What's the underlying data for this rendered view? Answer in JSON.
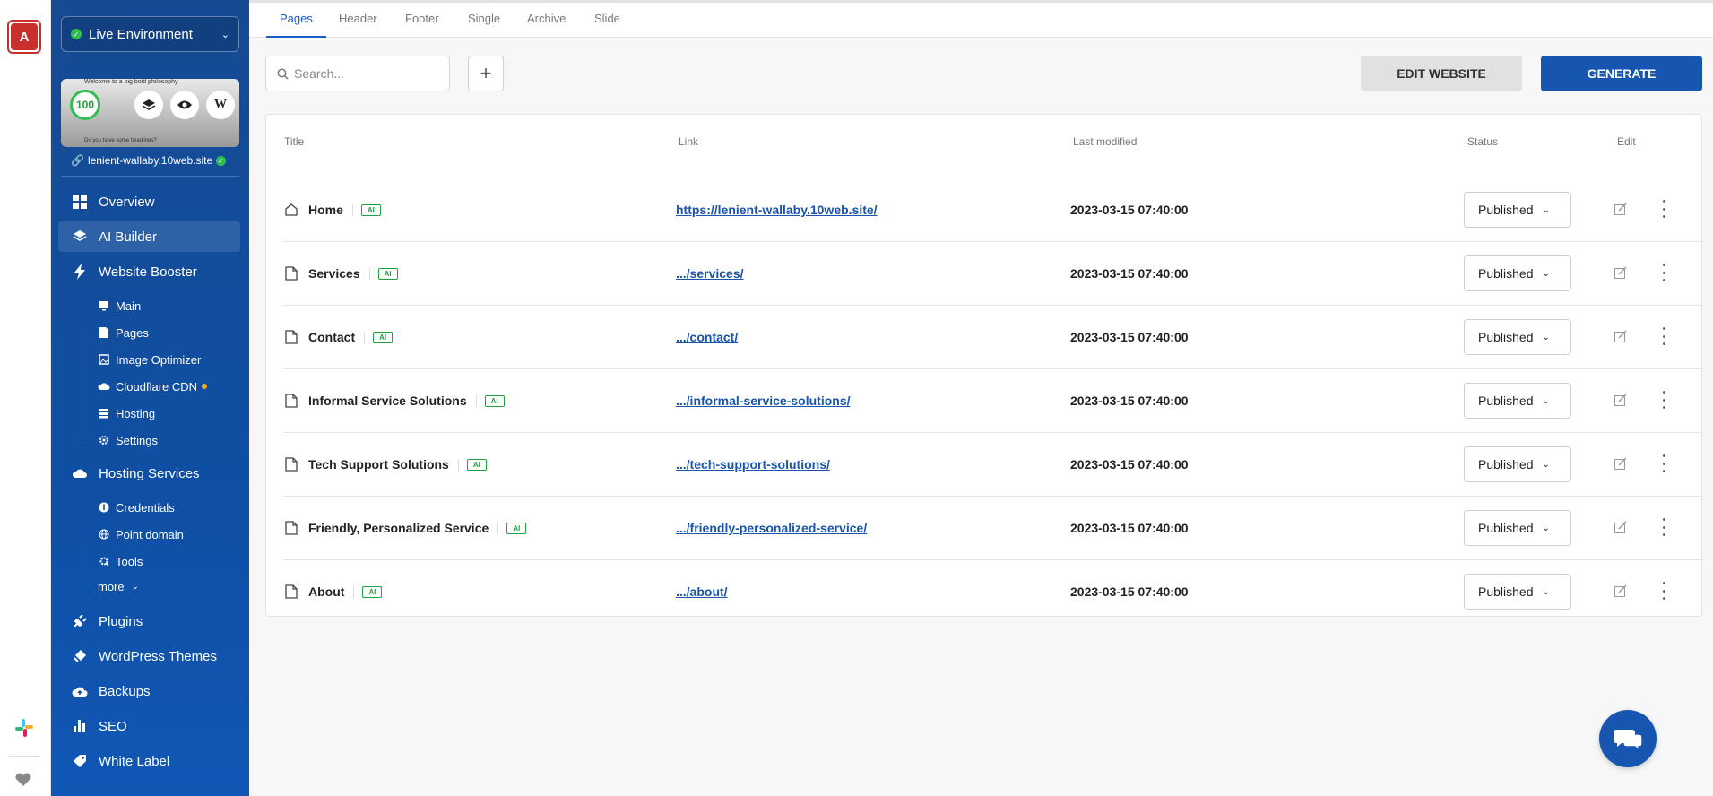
{
  "rail": {
    "avatar_letter": "A"
  },
  "sidebar": {
    "environment": "Live Environment",
    "preview": {
      "score": "100",
      "header_text": "Welcome to a big bold philosophy",
      "footer_text": "Do you have some headlines?"
    },
    "site_domain": "lenient-wallaby.10web.site",
    "nav": {
      "overview": "Overview",
      "ai_builder": "AI Builder",
      "website_booster": "Website Booster",
      "booster_sub": [
        "Main",
        "Pages",
        "Image Optimizer",
        "Cloudflare CDN",
        "Hosting",
        "Settings"
      ],
      "hosting_services": "Hosting Services",
      "hosting_sub": [
        "Credentials",
        "Point domain",
        "Tools"
      ],
      "more": "more",
      "plugins": "Plugins",
      "wordpress_themes": "WordPress Themes",
      "backups": "Backups",
      "seo": "SEO",
      "white_label": "White Label"
    }
  },
  "tabs": [
    "Pages",
    "Header",
    "Footer",
    "Single",
    "Archive",
    "Slide"
  ],
  "toolbar": {
    "search_placeholder": "Search...",
    "edit_website": "EDIT WEBSITE",
    "generate": "GENERATE"
  },
  "table": {
    "headers": {
      "title": "Title",
      "link": "Link",
      "modified": "Last modified",
      "status": "Status",
      "edit": "Edit"
    },
    "ai_label": "AI",
    "rows": [
      {
        "title": "Home",
        "icon": "home-icon",
        "link": "https://lenient-wallaby.10web.site/",
        "modified": "2023-03-15 07:40:00",
        "status": "Published"
      },
      {
        "title": "Services",
        "icon": "page-icon",
        "link": ".../services/",
        "modified": "2023-03-15 07:40:00",
        "status": "Published"
      },
      {
        "title": "Contact",
        "icon": "page-icon",
        "link": ".../contact/",
        "modified": "2023-03-15 07:40:00",
        "status": "Published"
      },
      {
        "title": "Informal Service Solutions",
        "icon": "page-icon",
        "link": ".../informal-service-solutions/",
        "modified": "2023-03-15 07:40:00",
        "status": "Published"
      },
      {
        "title": "Tech Support Solutions",
        "icon": "page-icon",
        "link": ".../tech-support-solutions/",
        "modified": "2023-03-15 07:40:00",
        "status": "Published"
      },
      {
        "title": "Friendly, Personalized Service",
        "icon": "page-icon",
        "link": ".../friendly-personalized-service/",
        "modified": "2023-03-15 07:40:00",
        "status": "Published"
      },
      {
        "title": "About",
        "icon": "page-icon",
        "link": ".../about/",
        "modified": "2023-03-15 07:40:00",
        "status": "Published"
      }
    ]
  },
  "colors": {
    "sidebar": "#164a93",
    "accent": "#1756b0",
    "ai_green": "#1aa33f",
    "link": "#1a54a8"
  }
}
